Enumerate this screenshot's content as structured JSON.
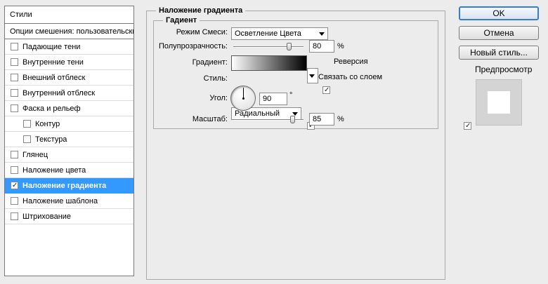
{
  "styles_panel": {
    "header": "Стили",
    "blending_options": "Опции смешения: пользовательские",
    "items": [
      {
        "label": "Падающие тени",
        "checked": false,
        "selected": false,
        "indent": false
      },
      {
        "label": "Внутренние тени",
        "checked": false,
        "selected": false,
        "indent": false
      },
      {
        "label": "Внешний отблеск",
        "checked": false,
        "selected": false,
        "indent": false
      },
      {
        "label": "Внутренний отблеск",
        "checked": false,
        "selected": false,
        "indent": false
      },
      {
        "label": "Фаска и рельеф",
        "checked": false,
        "selected": false,
        "indent": false
      },
      {
        "label": "Контур",
        "checked": false,
        "selected": false,
        "indent": true
      },
      {
        "label": "Текстура",
        "checked": false,
        "selected": false,
        "indent": true
      },
      {
        "label": "Глянец",
        "checked": false,
        "selected": false,
        "indent": false
      },
      {
        "label": "Наложение цвета",
        "checked": false,
        "selected": false,
        "indent": false
      },
      {
        "label": "Наложение градиента",
        "checked": true,
        "selected": true,
        "indent": false
      },
      {
        "label": "Наложение шаблона",
        "checked": false,
        "selected": false,
        "indent": false
      },
      {
        "label": "Штрихование",
        "checked": false,
        "selected": false,
        "indent": false
      }
    ]
  },
  "main": {
    "section_title": "Наложение градиента",
    "group_title": "Гадиент",
    "blend_mode": {
      "label": "Режим Смеси:",
      "value": "Осветление Цвета"
    },
    "opacity": {
      "label": "Полупрозрачность:",
      "value": "80",
      "unit": "%",
      "level": 80
    },
    "gradient": {
      "label": "Градиент:",
      "reverse_label": "Реверсия",
      "reverse_checked": true
    },
    "style": {
      "label": "Стиль:",
      "value": "Радиальный",
      "align_label": "Связать со слоем",
      "align_checked": true
    },
    "angle": {
      "label": "Угол:",
      "value": "90",
      "unit": "°"
    },
    "scale": {
      "label": "Масштаб:",
      "value": "85",
      "unit": "%",
      "level": 85
    }
  },
  "buttons": {
    "ok": "OK",
    "cancel": "Отмена",
    "new_style": "Новый стиль...",
    "preview_label": "Предпросмотр",
    "preview_checked": true
  },
  "colors": {
    "selection": "#3399ff",
    "default_button_border": "#3a7bd5"
  }
}
